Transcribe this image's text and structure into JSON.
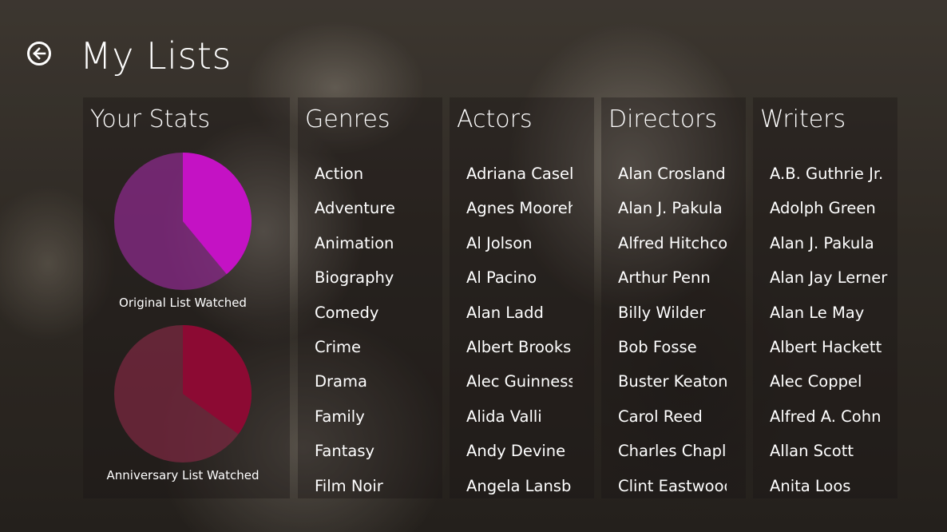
{
  "page": {
    "title": "My Lists"
  },
  "stats": {
    "title": "Your Stats",
    "original": {
      "label": "Original List Watched",
      "watched_fraction": 0.39,
      "color_watched": "#c412c4",
      "color_rest": "#8a2a8a"
    },
    "anniversary": {
      "label": "Anniversary List Watched",
      "watched_fraction": 0.35,
      "color_watched": "#8c0a33",
      "color_rest": "#7a2840"
    }
  },
  "genres": {
    "title": "Genres",
    "items": [
      "Action",
      "Adventure",
      "Animation",
      "Biography",
      "Comedy",
      "Crime",
      "Drama",
      "Family",
      "Fantasy",
      "Film Noir"
    ]
  },
  "actors": {
    "title": "Actors",
    "items": [
      "Adriana Caselo",
      "Agnes Mooreh",
      "Al Jolson",
      "Al Pacino",
      "Alan Ladd",
      "Albert Brooks",
      "Alec Guinness",
      "Alida Valli",
      "Andy Devine",
      "Angela Lansbu"
    ]
  },
  "directors": {
    "title": "Directors",
    "items": [
      "Alan Crosland",
      "Alan J. Pakula",
      "Alfred Hitchcoc",
      "Arthur Penn",
      "Billy Wilder",
      "Bob Fosse",
      "Buster Keaton",
      "Carol Reed",
      "Charles Chaplir",
      "Clint Eastwood"
    ]
  },
  "writers": {
    "title": "Writers",
    "items": [
      "A.B. Guthrie Jr.",
      "Adolph Green",
      "Alan J. Pakula",
      "Alan Jay Lerner",
      "Alan Le May",
      "Albert Hackett",
      "Alec Coppel",
      "Alfred A. Cohn",
      "Allan Scott",
      "Anita Loos"
    ]
  }
}
